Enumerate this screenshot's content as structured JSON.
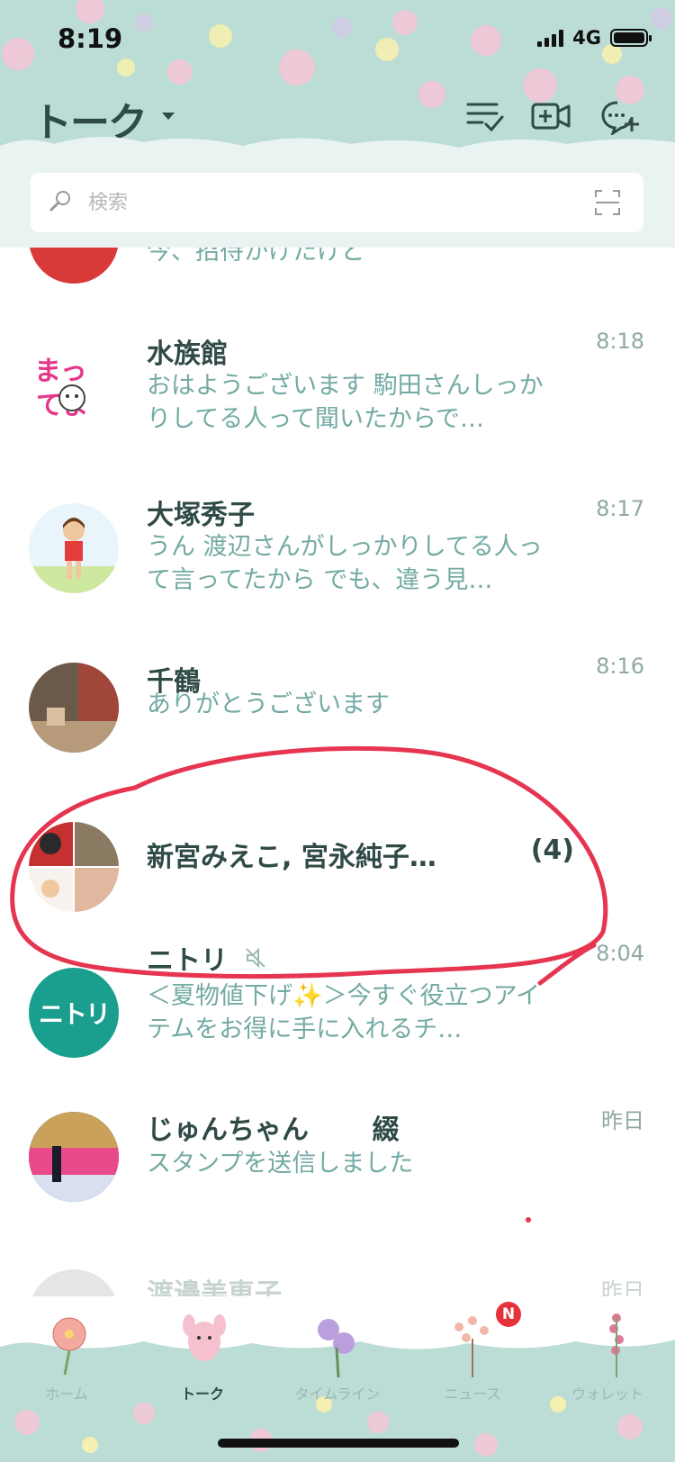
{
  "status_bar": {
    "time": "8:19",
    "network": "4G"
  },
  "header": {
    "title": "トーク"
  },
  "search": {
    "placeholder": "検索"
  },
  "chats": [
    {
      "name": "",
      "preview": "今、招待かけたけど",
      "time": ""
    },
    {
      "name": "水族館",
      "preview": "おはようございます 駒田さんしっかりしてる人って聞いたからで…",
      "time": "8:18"
    },
    {
      "name": "大塚秀子",
      "preview": "うん 渡辺さんがしっかりしてる人って言ってたから でも、違う見…",
      "time": "8:17"
    },
    {
      "name": "千鶴",
      "preview": "ありがとうございます",
      "time": "8:16"
    },
    {
      "name": "新宮みえこ, 宮永純子…",
      "count": "(4)"
    },
    {
      "name": "ニトリ",
      "preview": "＜夏物値下げ✨＞今すぐ役立つアイテムをお得に手に入れるチ…",
      "time": "8:04",
      "avatar_text": "ニトリ"
    },
    {
      "name": "じゅんちゃん",
      "name_suffix": "綴",
      "preview": "スタンプを送信しました",
      "time": "昨日"
    },
    {
      "name": "渡邊美恵子",
      "time": "昨日"
    }
  ],
  "nav": {
    "items": [
      {
        "label": "ホーム"
      },
      {
        "label": "トーク"
      },
      {
        "label": "タイムライン"
      },
      {
        "label": "ニュース",
        "badge": "N"
      },
      {
        "label": "ウォレット"
      }
    ]
  },
  "colors": {
    "accent": "#bcdcd6",
    "annotation": "#e63550",
    "badge": "#e8323b"
  }
}
